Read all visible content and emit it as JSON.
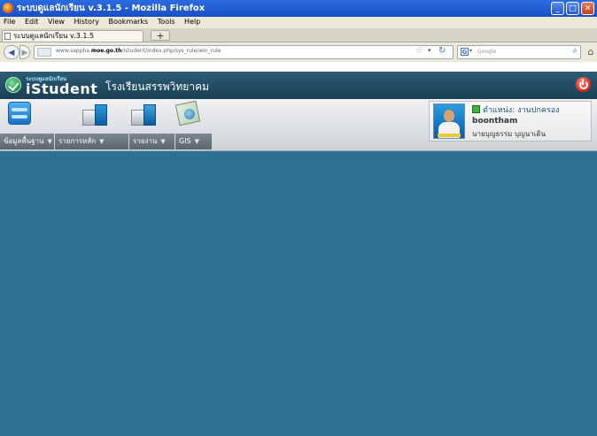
{
  "window": {
    "title": "ระบบดูแลนักเรียน v.3.1.5 - Mozilla Firefox",
    "controls": [
      "minimize",
      "maximize",
      "close"
    ]
  },
  "menu": [
    "File",
    "Edit",
    "View",
    "History",
    "Bookmarks",
    "Tools",
    "Help"
  ],
  "tab": {
    "label": "ระบบดูแลนักเรียน v.3.1.5",
    "new_tab": "+"
  },
  "nav": {
    "back": "◀",
    "forward": "▶",
    "url_prefix": "www.sappha.",
    "url_domain": "moe.go.th",
    "url_path": "/istudent/index.php/sys_rule/win_rule",
    "search_placeholder": "Google"
  },
  "app": {
    "logo_small": "ระบบดูแลนักเรียน",
    "logo_big": "iStudent",
    "school": "โรงเรียนสรรพวิทยาคม"
  },
  "modules": [
    {
      "label": "ข้อมูลพื้นฐาน",
      "icon": "database-icon"
    },
    {
      "label": "รายการหลัก",
      "icon": "main-items-icon"
    },
    {
      "label": "รายงาน",
      "icon": "reports-icon"
    },
    {
      "label": "GIS",
      "icon": "gis-map-icon"
    }
  ],
  "user": {
    "role": "ตำแหน่ง: งานปกครอง",
    "login": "boontham",
    "name": "นายบุญธรรม บุญนาเดิน"
  },
  "colors": {
    "content_bg": "#2d7193",
    "header_bg": "#224c65",
    "title_bar": "#1f5bd0"
  }
}
